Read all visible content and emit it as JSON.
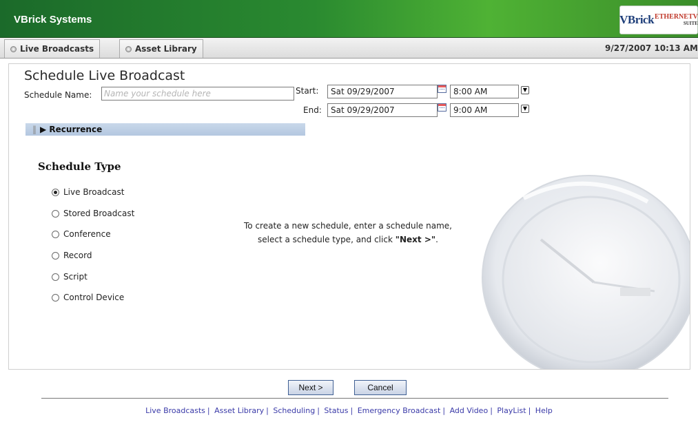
{
  "header": {
    "brand": "VBrick Systems",
    "logo_main": "VBrick",
    "logo_suffix": "ETHERNETV",
    "logo_sub": "SUITE"
  },
  "tabs": [
    {
      "label": "Live Broadcasts"
    },
    {
      "label": "Asset Library"
    }
  ],
  "datetime": "9/27/2007 10:13 AM",
  "form": {
    "title": "Schedule Live Broadcast",
    "name_label": "Schedule Name:",
    "name_placeholder": "Name your schedule here",
    "name_value": "",
    "start_label": "Start:",
    "start_date": "Sat 09/29/2007",
    "start_time": "8:00 AM",
    "end_label": "End:",
    "end_date": "Sat 09/29/2007",
    "end_time": "9:00 AM",
    "recurrence_label": "Recurrence"
  },
  "schedule_type": {
    "heading": "Schedule Type",
    "options": [
      "Live Broadcast",
      "Stored Broadcast",
      "Conference",
      "Record",
      "Script",
      "Control Device"
    ],
    "selected": "Live Broadcast"
  },
  "info": {
    "line1": "To create a new schedule, enter a schedule name,",
    "line2_prefix": "select a schedule type, and click",
    "line2_bold": "\"Next >\"",
    "line2_suffix": "."
  },
  "buttons": {
    "next": "Next >",
    "cancel": "Cancel"
  },
  "footer": {
    "links": [
      "Live Broadcasts",
      "Asset Library",
      "Scheduling",
      "Status",
      "Emergency Broadcast",
      "Add Video",
      "PlayList",
      "Help"
    ]
  },
  "colors": {
    "header_green": "#2a8a30",
    "recurrence_bar": "#b3c7e0",
    "link_blue": "#3a3aa8"
  }
}
